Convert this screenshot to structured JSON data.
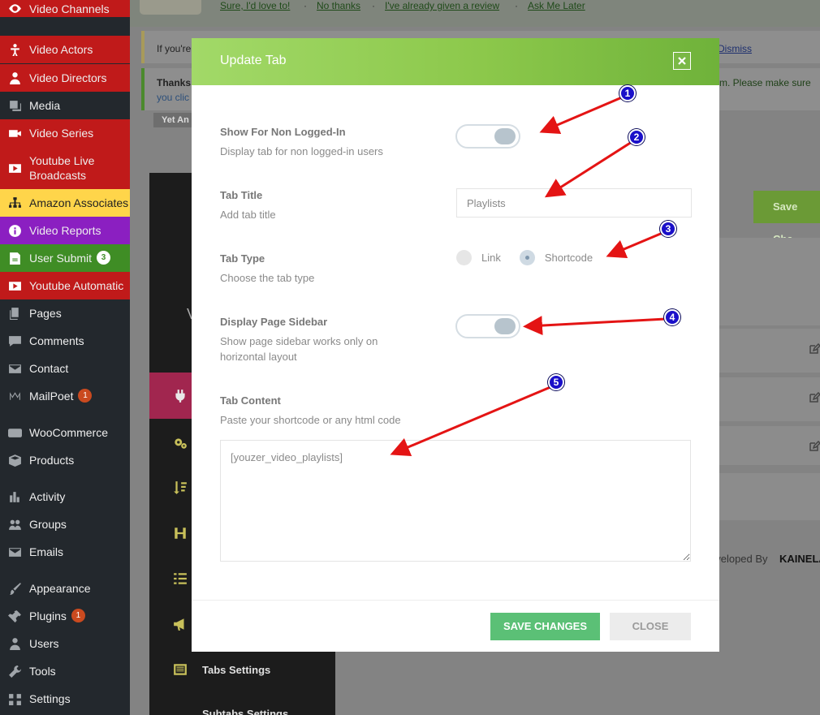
{
  "sidebar": {
    "items": [
      {
        "label": "Video Channels",
        "icon": "eye-icon",
        "color": "#c01a1a"
      },
      {
        "label": "Video Actors",
        "icon": "person-icon",
        "color": "#c01a1a"
      },
      {
        "label": "Video Directors",
        "icon": "director-icon",
        "color": "#c01a1a"
      },
      {
        "label": "Media",
        "icon": "media-icon",
        "color": "#23282d"
      },
      {
        "label": "Video Series",
        "icon": "video-camera-icon",
        "color": "#c01a1a"
      },
      {
        "label": "Youtube Live Broadcasts",
        "icon": "youtube-play-icon",
        "color": "#c01a1a"
      },
      {
        "label": "Amazon Associates",
        "icon": "sitemap-icon",
        "color": "#ffd54a"
      },
      {
        "label": "Video Reports",
        "icon": "info-icon",
        "color": "#8b1fc1"
      },
      {
        "label": "User Submit",
        "icon": "submit-icon",
        "color": "#3f8d25",
        "badge": "3"
      },
      {
        "label": "Youtube Automatic",
        "icon": "youtube-play-icon",
        "color": "#c01a1a"
      },
      {
        "label": "Pages",
        "icon": "pages-icon",
        "color": "#23282d"
      },
      {
        "label": "Comments",
        "icon": "comment-icon",
        "color": "#23282d"
      },
      {
        "label": "Contact",
        "icon": "mail-icon",
        "color": "#23282d"
      },
      {
        "label": "MailPoet",
        "icon": "mailpoet-icon",
        "color": "#23282d",
        "badge": "1"
      },
      {
        "label": "WooCommerce",
        "icon": "woo-icon",
        "color": "#23282d"
      },
      {
        "label": "Products",
        "icon": "box-icon",
        "color": "#23282d"
      },
      {
        "label": "Activity",
        "icon": "activity-icon",
        "color": "#23282d"
      },
      {
        "label": "Groups",
        "icon": "groups-icon",
        "color": "#23282d"
      },
      {
        "label": "Emails",
        "icon": "mail-icon",
        "color": "#23282d"
      },
      {
        "label": "Appearance",
        "icon": "brush-icon",
        "color": "#23282d"
      },
      {
        "label": "Plugins",
        "icon": "plugin-icon",
        "color": "#23282d",
        "badge": "1"
      },
      {
        "label": "Users",
        "icon": "user-icon",
        "color": "#23282d"
      },
      {
        "label": "Tools",
        "icon": "wrench-icon",
        "color": "#23282d"
      },
      {
        "label": "Settings",
        "icon": "settings-icon",
        "color": "#23282d"
      }
    ]
  },
  "background": {
    "review_links": [
      "Sure, I'd love to!",
      "No thanks",
      "I've already given a review",
      "Ask Me Later"
    ],
    "review_separator": "·",
    "notice1_text": "If you're",
    "notice1_dismiss": "Dismiss",
    "notice2_text_a": "Thanks",
    "notice2_text_b": "you clic",
    "notice2_right": "m. Please make sure",
    "notice2_button": "Yet An",
    "save_button": "Save Cha",
    "developed_by": "eveloped By",
    "developer": "KAINELA",
    "panel_letter": "V",
    "panel_items": [
      {
        "icon": "plug-icon"
      },
      {
        "icon": "gears-icon"
      },
      {
        "icon": "sort-icon"
      },
      {
        "icon": "heading-icon"
      },
      {
        "icon": "list-icon"
      },
      {
        "icon": "megaphone-icon"
      },
      {
        "icon": "tabs-icon",
        "label": "Tabs Settings"
      },
      {
        "icon": "subtabs-icon",
        "label": "Subtabs Settings"
      }
    ]
  },
  "modal": {
    "title": "Update Tab",
    "options": {
      "non_logged_in": {
        "title": "Show For Non Logged-In",
        "desc": "Display tab for non logged-in users",
        "enabled": true
      },
      "tab_title": {
        "title": "Tab Title",
        "desc": "Add tab title",
        "value": "Playlists"
      },
      "tab_type": {
        "title": "Tab Type",
        "desc": "Choose the tab type",
        "options": [
          "Link",
          "Shortcode"
        ],
        "selected": "Shortcode"
      },
      "page_sidebar": {
        "title": "Display Page Sidebar",
        "desc": "Show page sidebar works only on horizontal layout",
        "enabled": true
      },
      "tab_content": {
        "title": "Tab Content",
        "desc": "Paste your shortcode or any html code",
        "value": "[youzer_video_playlists]"
      }
    },
    "save_label": "SAVE CHANGES",
    "close_label": "CLOSE"
  },
  "annotations": {
    "numbers": [
      "1",
      "2",
      "3",
      "4",
      "5"
    ],
    "arrow_color": "#e41414",
    "badge_color": "#1a0fc9"
  }
}
